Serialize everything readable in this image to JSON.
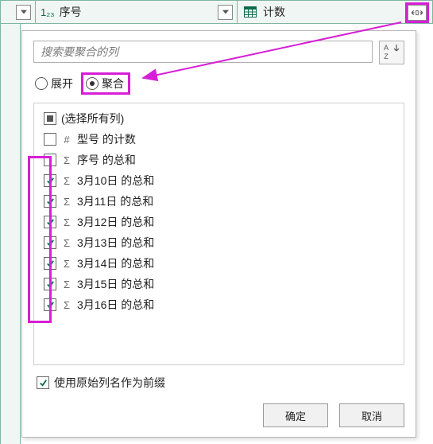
{
  "columns": {
    "col2_label": "序号",
    "col2_type_prefix": "1₂₃",
    "col3_label": "计数"
  },
  "search": {
    "placeholder": "搜索要聚合的列"
  },
  "mode": {
    "expand_label": "展开",
    "aggregate_label": "聚合",
    "selected": "aggregate"
  },
  "list": {
    "select_all": "(选择所有列)",
    "items": [
      {
        "checked": false,
        "icon": "#",
        "label": "型号 的计数"
      },
      {
        "checked": false,
        "icon": "Σ",
        "label": "序号 的总和"
      },
      {
        "checked": true,
        "icon": "Σ",
        "label": "3月10日 的总和"
      },
      {
        "checked": true,
        "icon": "Σ",
        "label": "3月11日 的总和"
      },
      {
        "checked": true,
        "icon": "Σ",
        "label": "3月12日 的总和"
      },
      {
        "checked": true,
        "icon": "Σ",
        "label": "3月13日 的总和"
      },
      {
        "checked": true,
        "icon": "Σ",
        "label": "3月14日 的总和"
      },
      {
        "checked": true,
        "icon": "Σ",
        "label": "3月15日 的总和"
      },
      {
        "checked": true,
        "icon": "Σ",
        "label": "3月16日 的总和"
      }
    ]
  },
  "prefix_option": {
    "checked": true,
    "label": "使用原始列名作为前缀"
  },
  "buttons": {
    "ok": "确定",
    "cancel": "取消"
  }
}
